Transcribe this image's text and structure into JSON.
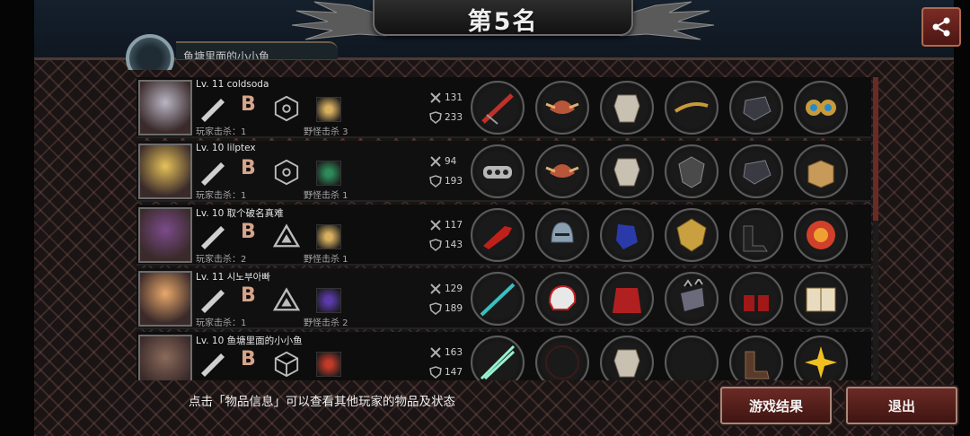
{
  "title": "第5名",
  "header": {
    "partial_label": "鱼塘里面的小小鱼"
  },
  "players": [
    {
      "level_name": "Lv. 11  coldsoda",
      "grade": "B",
      "pvp_kills": "玩家击杀：1",
      "mob_kills": "野怪击杀 3",
      "attack": "131",
      "defense": "233",
      "avatar_color": "#b9b5c4",
      "pet_color": "#d8b060",
      "class_shape": "hex",
      "items": [
        "red-crossbow-icon",
        "winged-helmet-icon",
        "silver-armor-icon",
        "golden-bow-icon",
        "dark-gauntlet-icon",
        "gem-earrings-icon"
      ]
    },
    {
      "level_name": "Lv. 10  lilptex",
      "grade": "B",
      "pvp_kills": "玩家击杀：1",
      "mob_kills": "野怪击杀 1",
      "attack": "94",
      "defense": "193",
      "avatar_color": "#e6c25a",
      "pet_color": "#2e8a5a",
      "class_shape": "hex",
      "items": [
        "knuckle-duster-icon",
        "winged-helmet-icon",
        "silver-armor-icon",
        "dark-shield-icon",
        "dark-gauntlet-icon",
        "cardboard-box-icon"
      ]
    },
    {
      "level_name": "Lv. 10  取个破名真难",
      "grade": "B",
      "pvp_kills": "玩家击杀：2",
      "mob_kills": "野怪击杀 1",
      "attack": "117",
      "defense": "143",
      "avatar_color": "#7b4b8a",
      "pet_color": "#d8b060",
      "class_shape": "triangle",
      "items": [
        "red-claw-icon",
        "knight-helmet-icon",
        "blue-gauntlet-icon",
        "golden-shield-icon",
        "black-boots-icon",
        "fire-orb-icon"
      ]
    },
    {
      "level_name": "Lv. 11  시노부아빠",
      "grade": "B",
      "pvp_kills": "玩家击杀：1",
      "mob_kills": "野怪击杀 2",
      "attack": "129",
      "defense": "189",
      "avatar_color": "#e8a86a",
      "pet_color": "#5a3aa8",
      "class_shape": "triangle",
      "items": [
        "cyan-spear-icon",
        "moto-helmet-icon",
        "red-jacket-icon",
        "spiked-gauntlet-icon",
        "red-heels-icon",
        "spell-book-icon"
      ]
    },
    {
      "level_name": "Lv. 10  鱼塘里面的小小鱼",
      "grade": "B",
      "pvp_kills": "",
      "mob_kills": "",
      "attack": "163",
      "defense": "147",
      "avatar_color": "#8a6a5a",
      "pet_color": "#c23a2a",
      "class_shape": "cube",
      "items": [
        "light-saber-icon",
        "dark-ring-icon",
        "silver-armor-icon",
        "empty-slot",
        "brown-boots-icon",
        "yellow-flower-icon"
      ]
    }
  ],
  "footer": {
    "tip": "点击「物品信息」可以查看其他玩家的物品及状态",
    "result_button": "游戏结果",
    "exit_button": "退出"
  },
  "colors": {
    "accent": "#6b2a24",
    "grade": "#d6a48a",
    "panel": "#0d0d0e"
  }
}
